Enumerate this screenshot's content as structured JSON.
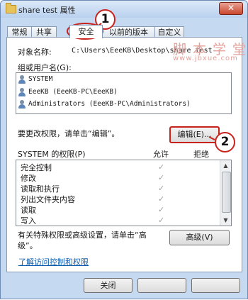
{
  "window": {
    "title": "share test 属性",
    "close_glyph": "✕"
  },
  "tabs": [
    {
      "label": "常规"
    },
    {
      "label": "共享"
    },
    {
      "label": "安全"
    },
    {
      "label": "以前的版本"
    },
    {
      "label": "自定义"
    }
  ],
  "security": {
    "object_label": "对象名称:",
    "object_value": "C:\\Users\\EeeKB\\Desktop\\share test",
    "groups_label": "组或用户名(G):",
    "users": [
      {
        "name": "SYSTEM",
        "icon": "users-icon"
      },
      {
        "name": "EeeKB (EeeKB-PC\\EeeKB)",
        "icon": "user-icon"
      },
      {
        "name": "Administrators (EeeKB-PC\\Administrators)",
        "icon": "users-icon"
      }
    ],
    "change_hint": "要更改权限，请单击“编辑”。",
    "edit_button": "编辑(E)...",
    "perm_header": "SYSTEM 的权限(P)",
    "allow_header": "允许",
    "deny_header": "拒绝",
    "permissions": [
      {
        "name": "完全控制",
        "allow": true,
        "deny": false
      },
      {
        "name": "修改",
        "allow": true,
        "deny": false
      },
      {
        "name": "读取和执行",
        "allow": true,
        "deny": false
      },
      {
        "name": "列出文件夹内容",
        "allow": true,
        "deny": false
      },
      {
        "name": "读取",
        "allow": true,
        "deny": false
      },
      {
        "name": "写入",
        "allow": true,
        "deny": false
      }
    ],
    "check_glyph": "✓",
    "advanced_hint_line1": "有关特殊权限或高级设置，请单击“高",
    "advanced_hint_line2": "级”。",
    "advanced_button": "高级(V)",
    "help_link": "了解访问控制和权限"
  },
  "footer": {
    "close_button": "关闭"
  },
  "annotations": {
    "badge1": "1",
    "badge2": "2",
    "accent_color": "#c8221d"
  },
  "watermark": {
    "line1": "脚本学堂",
    "line2": "www.jbxue.com"
  }
}
